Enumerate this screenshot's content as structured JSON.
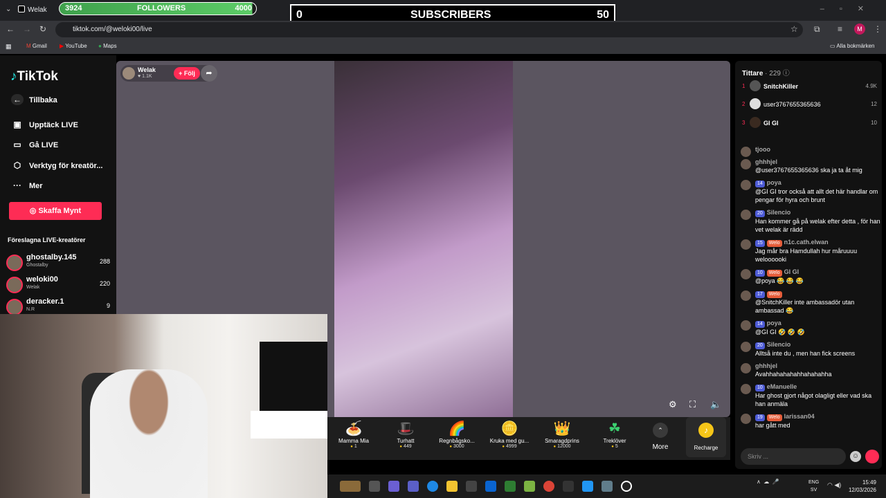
{
  "browser": {
    "tab_title": "Welak",
    "url": "tiktok.com/@weloki00/live",
    "bookmarks": [
      "Gmail",
      "YouTube",
      "Maps"
    ],
    "all_bookmarks": "Alla bokmärken",
    "profile_initial": "M"
  },
  "overlay": {
    "followers_current": "3924",
    "followers_label": "FOLLOWERS",
    "followers_goal": "4000",
    "followers_progress_fraction": 0.98,
    "subs_current": "0",
    "subs_label": "SUBSCRIBERS",
    "subs_goal": "50"
  },
  "sidebar": {
    "logo": "TikTok",
    "back": "Tillbaka",
    "items": [
      {
        "label": "Upptäck LIVE",
        "icon": "calendar-live-icon"
      },
      {
        "label": "Gå LIVE",
        "icon": "camera-icon"
      },
      {
        "label": "Verktyg för kreatör...",
        "icon": "creator-tools-icon"
      },
      {
        "label": "Mer",
        "icon": "more-dots-icon"
      }
    ],
    "coins_button": "Skaffa Mynt",
    "suggested_title": "Föreslagna LIVE-kreatörer",
    "creators": [
      {
        "name": "ghostalby.145",
        "sub": "Ghostalby",
        "count": "288"
      },
      {
        "name": "weloki00",
        "sub": "Welak",
        "count": "220"
      },
      {
        "name": "deracker.1",
        "sub": "N.R",
        "count": "9"
      }
    ]
  },
  "stream": {
    "host_name": "Welak",
    "host_likes": "1.1K",
    "follow_label": "+ Följ"
  },
  "gifts": [
    {
      "name": "Mamma Mia",
      "price": "1",
      "icon": "🍝"
    },
    {
      "name": "Turhatt",
      "price": "449",
      "icon": "🎩"
    },
    {
      "name": "Regnbågsko...",
      "price": "3000",
      "icon": "🌈"
    },
    {
      "name": "Kruka med gu...",
      "price": "4999",
      "icon": "🪙"
    },
    {
      "name": "Smaragdprins",
      "price": "12000",
      "icon": "👑"
    },
    {
      "name": "Treklöver",
      "price": "5",
      "icon": "☘"
    }
  ],
  "more_label": "More",
  "recharge_label": "Recharge",
  "chat": {
    "viewers_label": "Tittare",
    "viewers_count": "· 229",
    "ranking": [
      {
        "rank": "1",
        "name": "SnitchKiller",
        "value": "4.9K"
      },
      {
        "rank": "2",
        "name": "user3767655365636",
        "value": "12"
      },
      {
        "rank": "3",
        "name": "GI GI",
        "value": "10"
      }
    ],
    "messages": [
      {
        "user": "tjooo",
        "level": "",
        "badge": "",
        "text": ""
      },
      {
        "user": "ghhhjel",
        "level": "",
        "badge": "",
        "text": "@user3767655365636 ska ja ta åt mig"
      },
      {
        "user": "poya",
        "level": "14",
        "badge": "",
        "text": "@GI GI tror också att allt det här handlar om pengar för hyra och brunt"
      },
      {
        "user": "Silencio",
        "level": "20",
        "badge": "",
        "text": "Han kommer gå på welak efter detta , för han vet welak är rädd"
      },
      {
        "user": "n1c.cath.elwan",
        "level": "15",
        "badge": "Welo",
        "text": "Jag mår bra Hamdullah hur måruuuu weloooooki"
      },
      {
        "user": "GI GI",
        "level": "10",
        "badge": "Welo",
        "text": "@poya 😂 😂 😂"
      },
      {
        "user": "",
        "level": "17",
        "badge": "Welo",
        "text": "@SnitchKiller inte ambassadör utan ambassad 😂"
      },
      {
        "user": "poya",
        "level": "14",
        "badge": "",
        "text": "@GI GI 🤣 🤣 🤣"
      },
      {
        "user": "Silencio",
        "level": "20",
        "badge": "",
        "text": "Alltså inte du , men han fick screens"
      },
      {
        "user": "ghhhjel",
        "level": "",
        "badge": "",
        "text": "Avahhahahahahhahahahha"
      },
      {
        "user": "eManuelle",
        "level": "10",
        "badge": "",
        "text": "Har ghost gjort något olagligt eller vad ska han anmäla"
      },
      {
        "user": "larissan04",
        "level": "19",
        "badge": "Welo",
        "text": "har gått med"
      }
    ],
    "input_placeholder": "Skriv ..."
  },
  "taskbar": {
    "lang_top": "ENG",
    "lang_bottom": "SV",
    "time": "15:49",
    "date": "12/03/2026"
  }
}
